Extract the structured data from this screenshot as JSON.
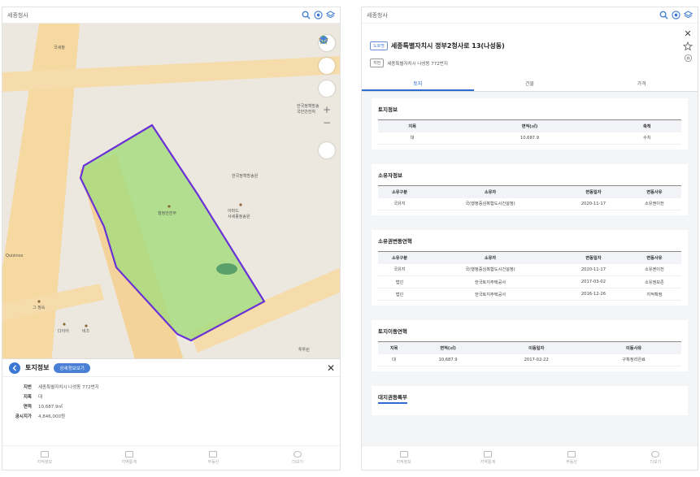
{
  "app": {
    "title": "세종청사"
  },
  "left": {
    "map_labels": [
      {
        "text": "국세청"
      },
      {
        "text": "한국정책방송\n국민안전처"
      },
      {
        "text": "한국정책방송원"
      },
      {
        "text": "아마드\n사세종정송원"
      },
      {
        "text": "행정안전부"
      },
      {
        "text": "Quizinos"
      },
      {
        "text": "그 정숙"
      },
      {
        "text": "다이어"
      },
      {
        "text": "비츠"
      },
      {
        "text": "투투린"
      }
    ],
    "sheet": {
      "title": "토지정보",
      "detail_button": "상세정보보기",
      "rows": [
        {
          "k": "지번",
          "v": "세종특별자치시 나성동 772번지"
        },
        {
          "k": "지목",
          "v": "대"
        },
        {
          "k": "면적",
          "v": "10,687.9㎡"
        },
        {
          "k": "공시지가",
          "v": "4,846,000원"
        }
      ]
    },
    "nav": [
      {
        "label": "지적정보",
        "icon": "map-icon"
      },
      {
        "label": "지역통계",
        "icon": "chart-icon"
      },
      {
        "label": "부동산",
        "icon": "building-icon"
      },
      {
        "label": "더보기",
        "icon": "clock-icon"
      }
    ]
  },
  "right": {
    "road_badge": "도로명",
    "address": "세종특별자치시 정부2청사로 13(나성동)",
    "jibun_badge": "지번",
    "jibun_address": "세종특별자치시 나성동 772번지",
    "tabs": [
      {
        "label": "토지"
      },
      {
        "label": "건물"
      },
      {
        "label": "가격"
      }
    ],
    "land_info": {
      "title": "토지정보",
      "headers": [
        "지목",
        "면적(㎡)",
        "축척"
      ],
      "rows": [
        [
          "대",
          "10,687.9",
          "수치"
        ]
      ]
    },
    "owner_info": {
      "title": "소유자정보",
      "headers": [
        "소유구분",
        "소유자",
        "변동일자",
        "변동사유"
      ],
      "rows": [
        [
          "국유지",
          "국(행정중심복합도시건설청)",
          "2020-11-17",
          "소유권이전"
        ]
      ]
    },
    "owner_history": {
      "title": "소유권변동연혁",
      "headers": [
        "소유구분",
        "소유자",
        "변동일자",
        "변동사유"
      ],
      "rows": [
        [
          "국유지",
          "국(행정중심복합도시건설청)",
          "2020-11-17",
          "소유권이전"
        ],
        [
          "법인",
          "한국토지주택공사",
          "2017-03-02",
          "소유권보존"
        ],
        [
          "법인",
          "한국토지주택공사",
          "2016-12-26",
          "지적확정"
        ]
      ]
    },
    "land_move": {
      "title": "토지이동연혁",
      "headers": [
        "지목",
        "면적(㎡)",
        "이동일자",
        "이동사유"
      ],
      "rows": [
        [
          "대",
          "10,687.9",
          "2017-02-22",
          "구획정리완료"
        ]
      ]
    },
    "next_section": {
      "title": "대지권등록부"
    },
    "nav": [
      {
        "label": "지적정보"
      },
      {
        "label": "지역통계"
      },
      {
        "label": "부동산"
      },
      {
        "label": "더보기"
      }
    ]
  }
}
